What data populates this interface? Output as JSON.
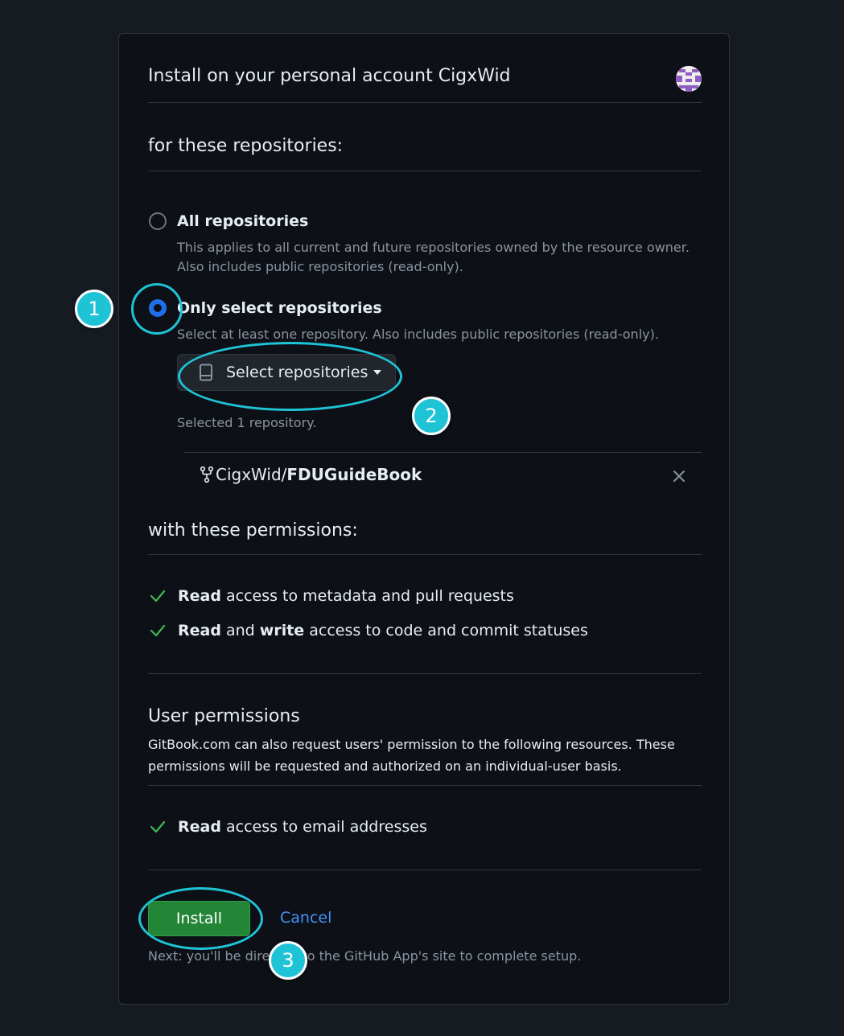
{
  "header": {
    "title": "Install on your personal account CigxWid"
  },
  "repos_section": {
    "heading": "for these repositories:",
    "options": [
      {
        "label": "All repositories",
        "description": "This applies to all current and future repositories owned by the resource owner. Also includes public repositories (read-only).",
        "selected": false
      },
      {
        "label": "Only select repositories",
        "description": "Select at least one repository. Also includes public repositories (read-only).",
        "selected": true
      }
    ],
    "select_button_label": "Select repositories",
    "selected_count_text": "Selected 1 repository.",
    "selected_repo": {
      "owner": "CigxWid/",
      "name": "FDUGuideBook"
    }
  },
  "permissions_section": {
    "heading": "with these permissions:",
    "items": [
      {
        "parts": [
          "Read",
          " access to metadata and pull requests"
        ]
      },
      {
        "parts": [
          "Read",
          " and ",
          "write",
          " access to code and commit statuses"
        ]
      }
    ]
  },
  "user_permissions": {
    "heading": "User permissions",
    "description": "GitBook.com can also request users' permission to the following resources. These permissions will be requested and authorized on an individual-user basis.",
    "items": [
      {
        "parts": [
          "Read",
          " access to email addresses"
        ]
      }
    ]
  },
  "actions": {
    "install_label": "Install",
    "cancel_label": "Cancel",
    "next_note": "Next: you'll be directed to the GitHub App's site to complete setup."
  },
  "annotations": {
    "badges": [
      "1",
      "2",
      "3"
    ],
    "accent_color": "#1fc3d6"
  },
  "colors": {
    "background": "#161b22",
    "card": "#0d1117",
    "install_green": "#238636",
    "link_blue": "#4493f8",
    "radio_blue": "#1f6feb",
    "check_green": "#3fb950"
  }
}
